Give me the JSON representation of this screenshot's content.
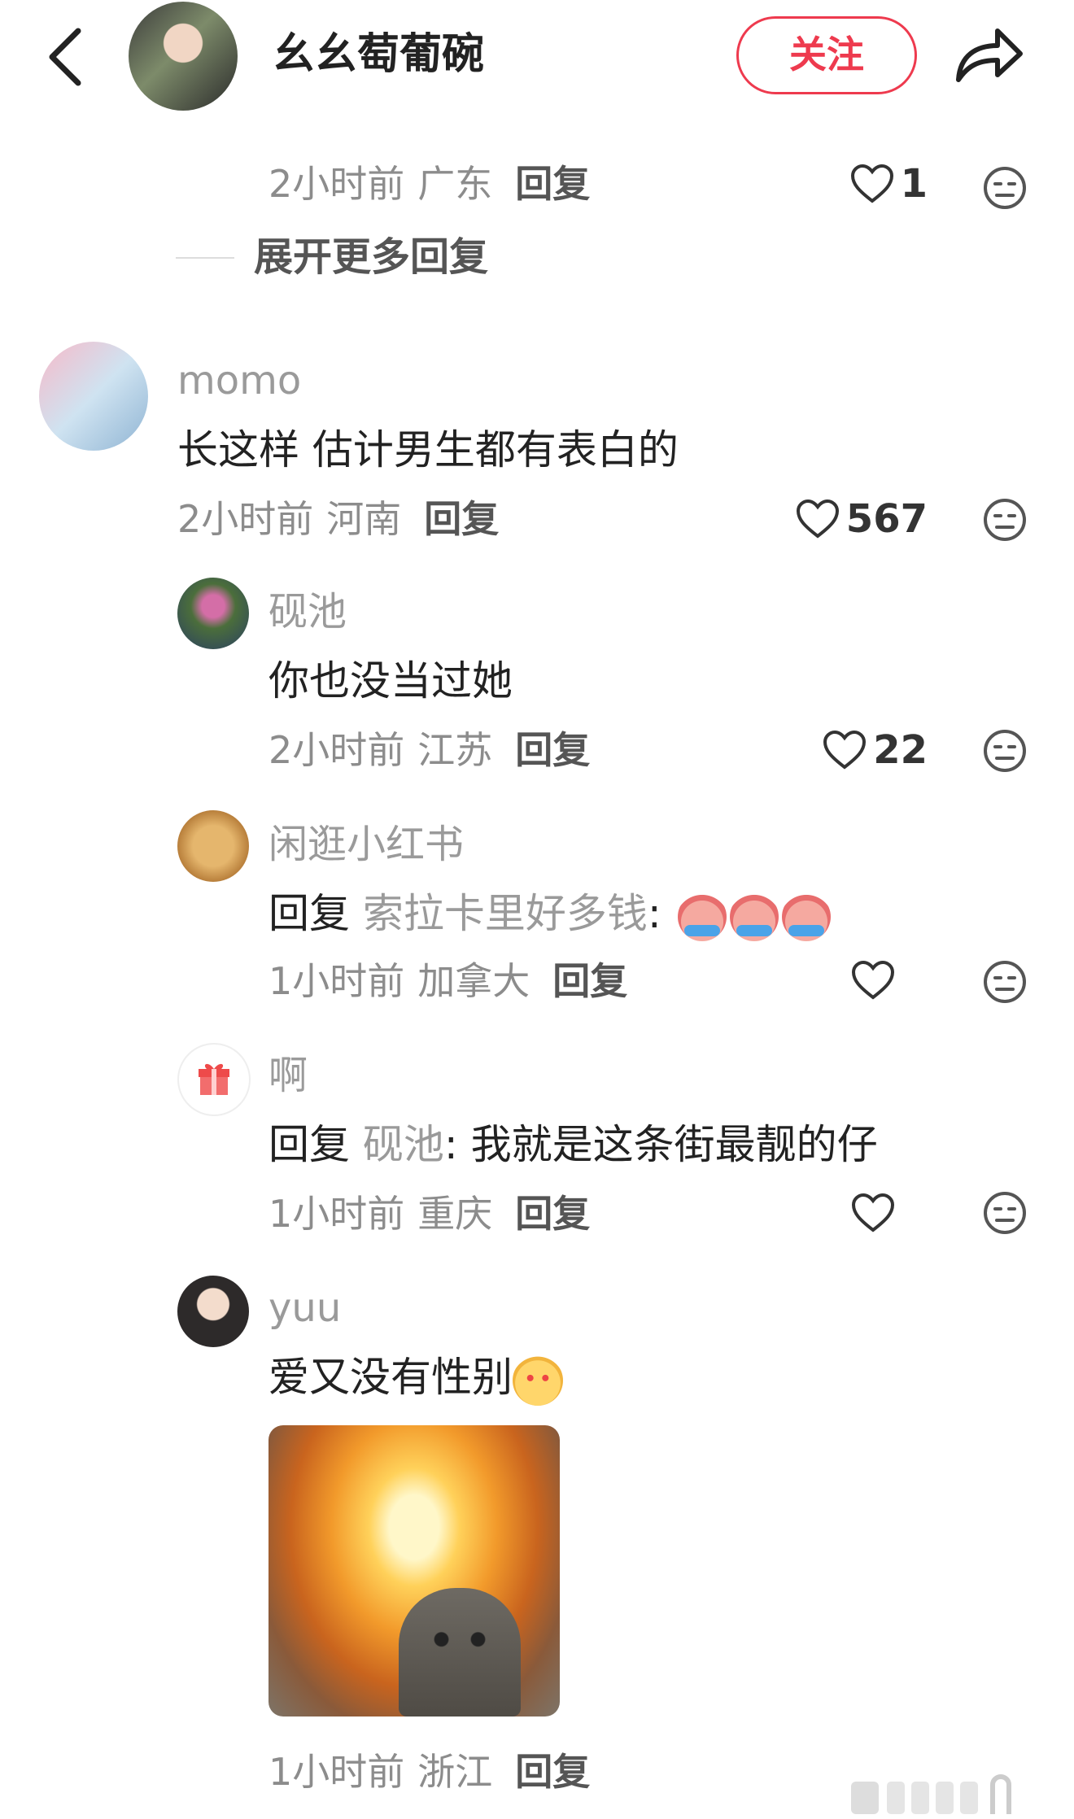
{
  "header": {
    "name": "幺幺萄葡碗",
    "follow_label": "关注"
  },
  "top_reply": {
    "time": "2小时前",
    "location": "广东",
    "reply_label": "回复",
    "likes": "1"
  },
  "expand_label": "展开更多回复",
  "comments": [
    {
      "user": "momo",
      "text": "长这样 估计男生都有表白的",
      "time": "2小时前",
      "location": "河南",
      "reply_label": "回复",
      "likes": "567"
    },
    {
      "user": "砚池",
      "text": "你也没当过她",
      "time": "2小时前",
      "location": "江苏",
      "reply_label": "回复",
      "likes": "22"
    },
    {
      "user": "闲逛小红书",
      "prefix": "回复",
      "mention": "索拉卡里好多钱",
      "colon": ":",
      "time": "1小时前",
      "location": "加拿大",
      "reply_label": "回复",
      "likes": ""
    },
    {
      "user": "啊",
      "prefix": "回复",
      "mention": "砚池",
      "colon": ":",
      "text": "我就是这条街最靓的仔",
      "time": "1小时前",
      "location": "重庆",
      "reply_label": "回复",
      "likes": ""
    },
    {
      "user": "yuu",
      "text": "爱又没有性别",
      "time": "1小时前",
      "location": "浙江",
      "reply_label": "回复"
    }
  ],
  "icons": {
    "back": "chevron-left-icon",
    "share": "share-arrow-icon",
    "like": "heart-icon",
    "dislike": "dislike-face-icon",
    "gift": "gift-icon"
  },
  "colors": {
    "accent": "#ee3a4e",
    "meta": "#8c8c8c"
  }
}
